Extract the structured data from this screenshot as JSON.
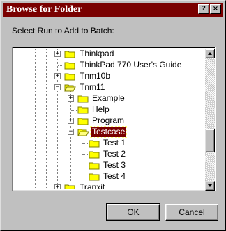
{
  "window": {
    "title": "Browse for Folder",
    "help_button": "?",
    "close_button": "×"
  },
  "prompt": "Select Run to Add to Batch:",
  "tree": {
    "items": [
      {
        "label": "Thinkpad",
        "expander": "+",
        "selected": false,
        "open": false
      },
      {
        "label": "ThinkPad 770 User's Guide",
        "expander": "",
        "selected": false,
        "open": false
      },
      {
        "label": "Tnm10b",
        "expander": "+",
        "selected": false,
        "open": false
      },
      {
        "label": "Tnm11",
        "expander": "−",
        "selected": false,
        "open": true
      },
      {
        "label": "Example",
        "expander": "+",
        "selected": false,
        "open": false
      },
      {
        "label": "Help",
        "expander": "",
        "selected": false,
        "open": false
      },
      {
        "label": "Program",
        "expander": "+",
        "selected": false,
        "open": false
      },
      {
        "label": "Testcase",
        "expander": "−",
        "selected": true,
        "open": true
      },
      {
        "label": "Test 1",
        "expander": "",
        "selected": false,
        "open": false
      },
      {
        "label": "Test 2",
        "expander": "",
        "selected": false,
        "open": false
      },
      {
        "label": "Test 3",
        "expander": "",
        "selected": false,
        "open": false
      },
      {
        "label": "Test 4",
        "expander": "",
        "selected": false,
        "open": false
      },
      {
        "label": "Tranxit",
        "expander": "+",
        "selected": false,
        "open": false
      }
    ]
  },
  "buttons": {
    "ok": "OK",
    "cancel": "Cancel"
  },
  "colors": {
    "titlebar": "#7a0000",
    "selection": "#7a0000",
    "face": "#c0c0c0",
    "folder": "#ffff00"
  },
  "icons": {
    "folder": "folder-icon",
    "open_folder": "open-folder-icon",
    "scroll_up": "scroll-up-arrow-icon",
    "scroll_down": "scroll-down-arrow-icon"
  }
}
